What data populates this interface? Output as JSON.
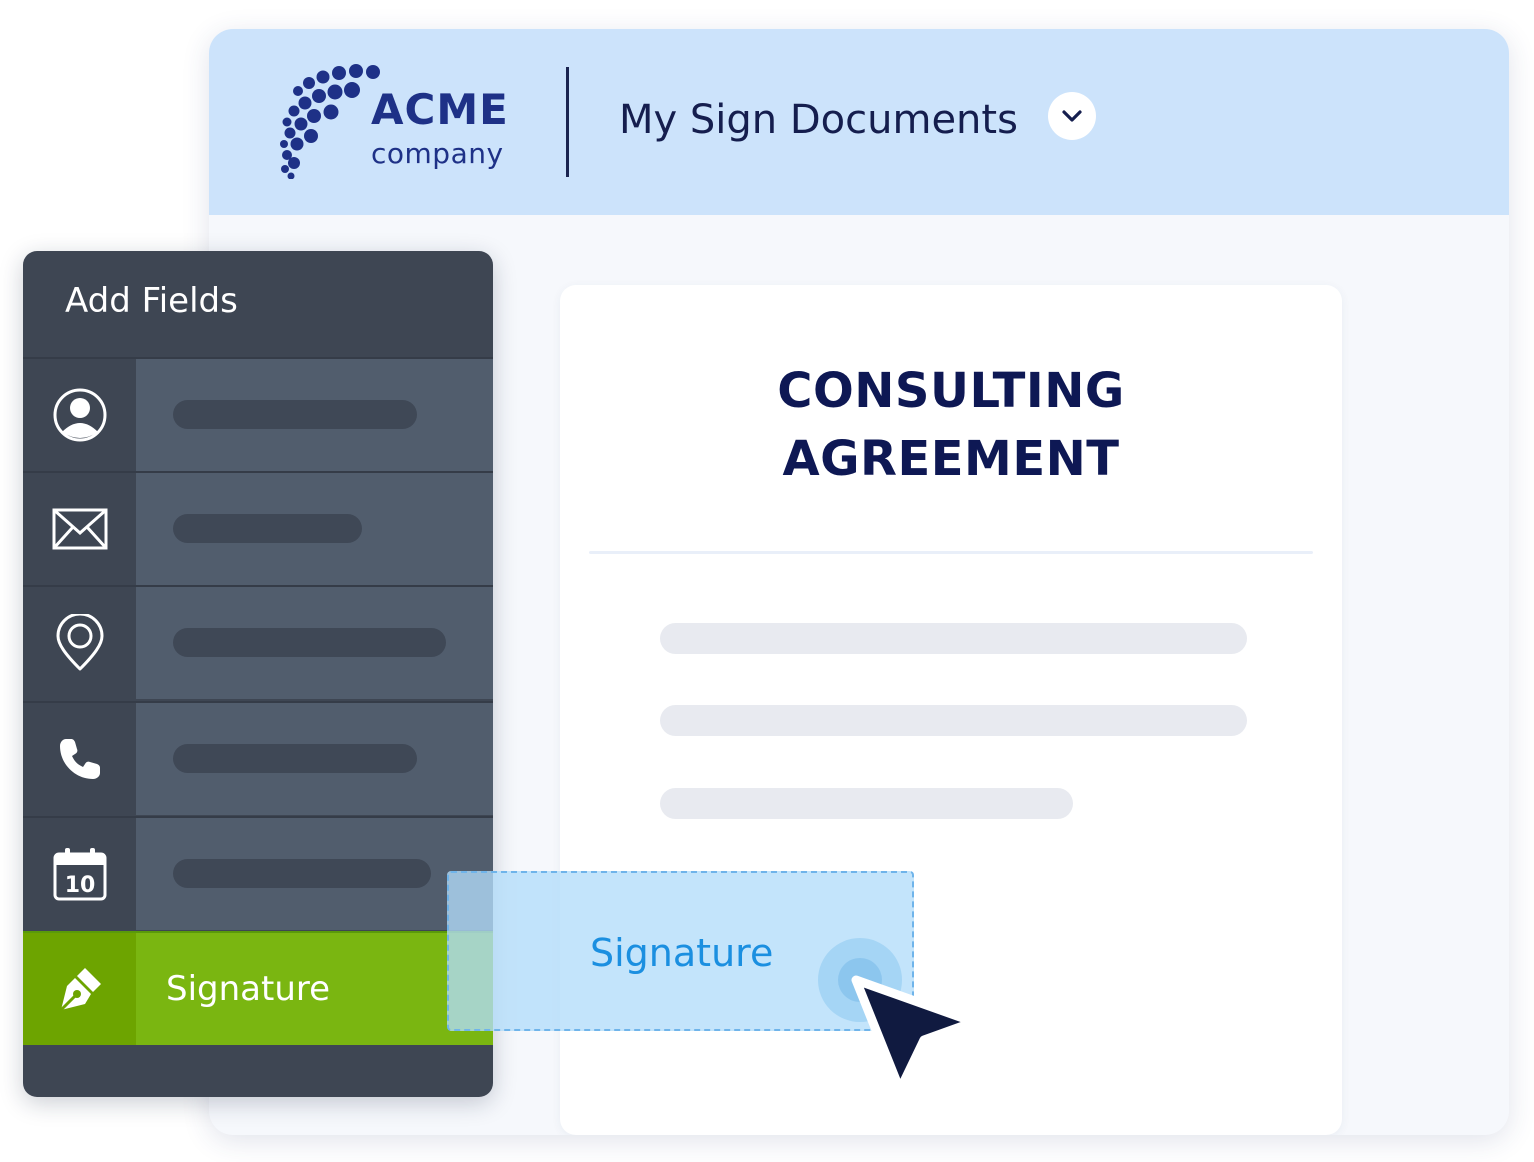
{
  "header": {
    "brand_name": "ACME",
    "brand_sub": "company",
    "menu_title": "My Sign Documents",
    "dropdown_icon": "chevron-down-icon"
  },
  "document": {
    "title_line1": "CONSULTING",
    "title_line2": "AGREEMENT"
  },
  "fields_panel": {
    "title": "Add Fields",
    "items": [
      {
        "icon": "user-icon"
      },
      {
        "icon": "envelope-icon"
      },
      {
        "icon": "location-pin-icon"
      },
      {
        "icon": "phone-icon"
      },
      {
        "icon": "calendar-icon",
        "icon_text": "10"
      },
      {
        "icon": "pen-nib-icon",
        "label": "Signature",
        "active": true
      }
    ]
  },
  "drag_field": {
    "label": "Signature"
  },
  "colors": {
    "header_bg": "#cce3fb",
    "brand": "#1e3187",
    "panel_bg": "#3e4653",
    "active_green": "#7ab611",
    "drag_blue": "#1b8fe0",
    "title_navy": "#0e1854"
  }
}
